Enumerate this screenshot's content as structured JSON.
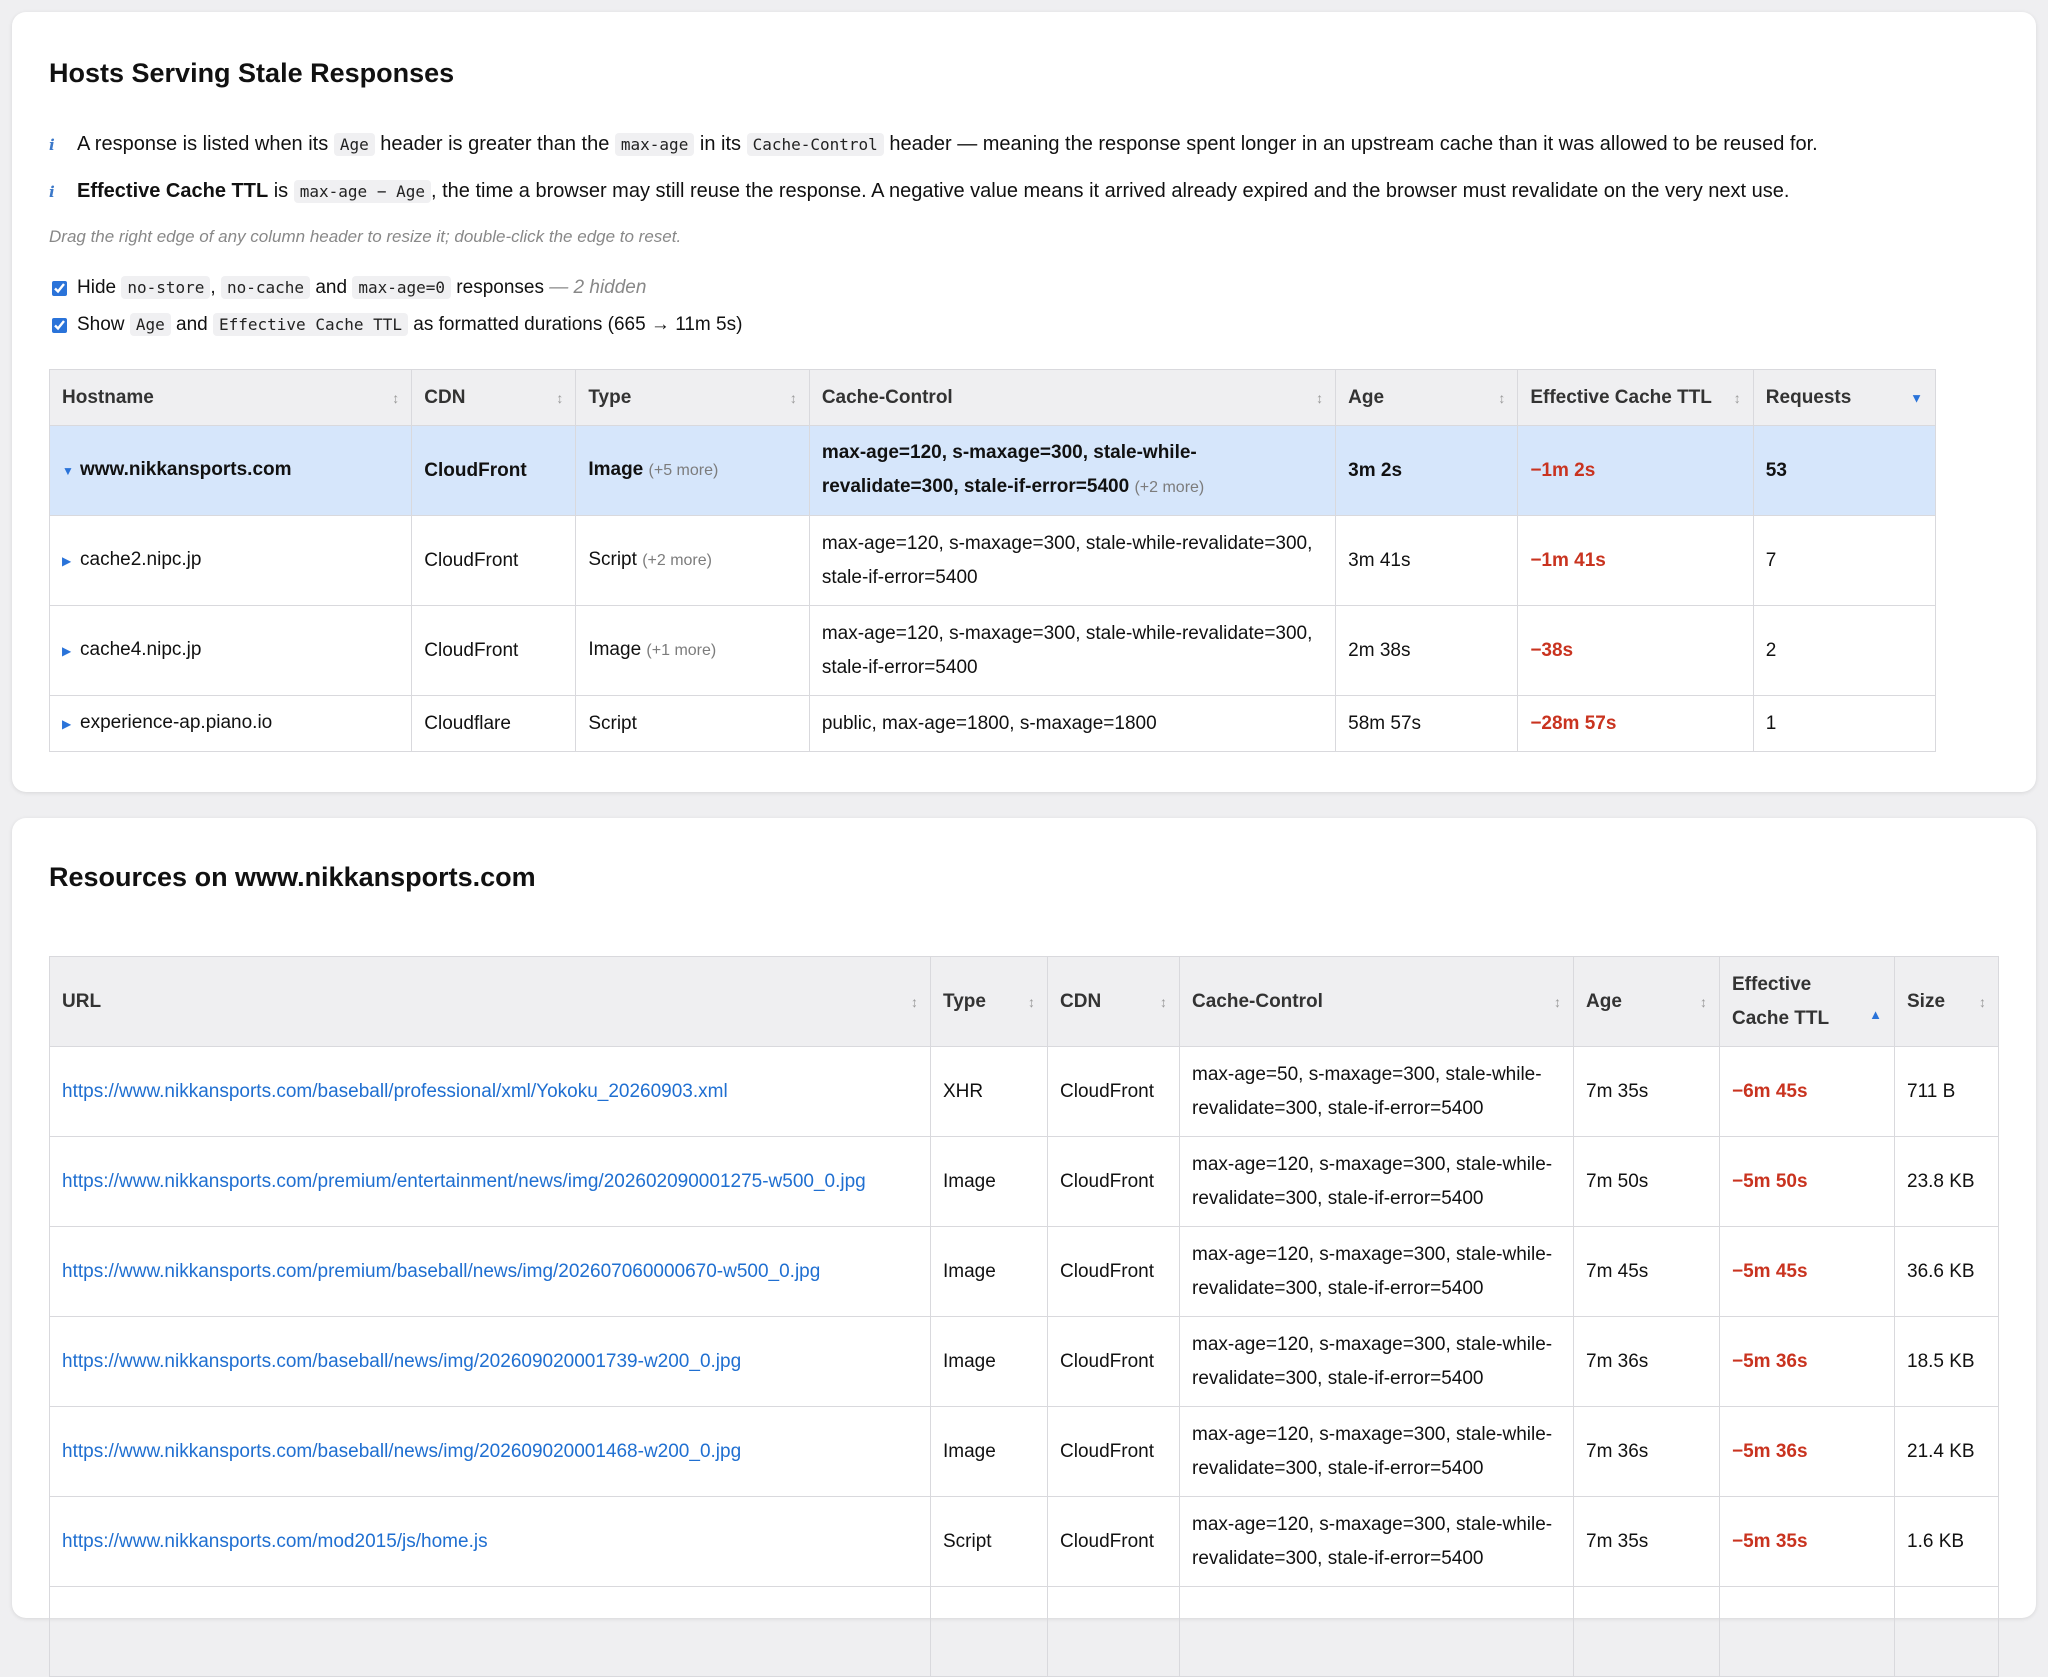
{
  "hosts_panel": {
    "title": "Hosts Serving Stale Responses",
    "info1": {
      "t1": "A response is listed when its",
      "c1": "Age",
      "t2": "header is greater than the",
      "c2": "max-age",
      "t3": "in its",
      "c3": "Cache-Control",
      "t4": "header — meaning the response spent longer in an upstream cache than it was allowed to be reused for."
    },
    "info2": {
      "bold": "Effective Cache TTL",
      "t1": "is",
      "c1": "max-age − Age",
      "t2": ", the time a browser may still reuse the response. A negative value means it arrived already expired and the browser must revalidate on the very next use."
    },
    "hint": "Drag the right edge of any column header to resize it; double-click the edge to reset.",
    "check_hide": {
      "t1": "Hide",
      "c1": "no-store",
      "sep": ",",
      "c2": "no-cache",
      "t2": "and",
      "c3": "max-age=0",
      "t3": "responses",
      "note": "— 2 hidden"
    },
    "check_show": {
      "t1": "Show",
      "c1": "Age",
      "t2": "and",
      "c2": "Effective Cache TTL",
      "t3": "as formatted durations (665 → 11m 5s)"
    },
    "columns": [
      "Hostname",
      "CDN",
      "Type",
      "Cache-Control",
      "Age",
      "Effective Cache TTL",
      "Requests"
    ],
    "rows": [
      {
        "host": "www.nikkansports.com",
        "cdn": "CloudFront",
        "type": "Image",
        "type_more": "(+5 more)",
        "cc": "max-age=120, s-maxage=300, stale-while-revalidate=300, stale-if-error=5400",
        "cc_more": "(+2 more)",
        "age": "3m 2s",
        "ttl": "−1m 2s",
        "req": "53"
      },
      {
        "host": "cache2.nipc.jp",
        "cdn": "CloudFront",
        "type": "Script",
        "type_more": "(+2 more)",
        "cc": "max-age=120, s-maxage=300, stale-while-revalidate=300, stale-if-error=5400",
        "cc_more": "",
        "age": "3m 41s",
        "ttl": "−1m 41s",
        "req": "7"
      },
      {
        "host": "cache4.nipc.jp",
        "cdn": "CloudFront",
        "type": "Image",
        "type_more": "(+1 more)",
        "cc": "max-age=120, s-maxage=300, stale-while-revalidate=300, stale-if-error=5400",
        "cc_more": "",
        "age": "2m 38s",
        "ttl": "−38s",
        "req": "2"
      },
      {
        "host": "experience-ap.piano.io",
        "cdn": "Cloudflare",
        "type": "Script",
        "type_more": "",
        "cc": "public, max-age=1800, s-maxage=1800",
        "cc_more": "",
        "age": "58m 57s",
        "ttl": "−28m 57s",
        "req": "1"
      }
    ]
  },
  "resources_panel": {
    "title": "Resources on www.nikkansports.com",
    "columns": [
      "URL",
      "Type",
      "CDN",
      "Cache-Control",
      "Age",
      "Effective Cache TTL",
      "Size"
    ],
    "rows": [
      {
        "url": "https://www.nikkansports.com/baseball/professional/xml/Yokoku_20260903.xml",
        "type": "XHR",
        "cdn": "CloudFront",
        "cc": "max-age=50, s-maxage=300, stale-while-revalidate=300, stale-if-error=5400",
        "age": "7m 35s",
        "ttl": "−6m 45s",
        "size": "711 B"
      },
      {
        "url": "https://www.nikkansports.com/premium/entertainment/news/img/202602090001275-w500_0.jpg",
        "type": "Image",
        "cdn": "CloudFront",
        "cc": "max-age=120, s-maxage=300, stale-while-revalidate=300, stale-if-error=5400",
        "age": "7m 50s",
        "ttl": "−5m 50s",
        "size": "23.8 KB"
      },
      {
        "url": "https://www.nikkansports.com/premium/baseball/news/img/202607060000670-w500_0.jpg",
        "type": "Image",
        "cdn": "CloudFront",
        "cc": "max-age=120, s-maxage=300, stale-while-revalidate=300, stale-if-error=5400",
        "age": "7m 45s",
        "ttl": "−5m 45s",
        "size": "36.6 KB"
      },
      {
        "url": "https://www.nikkansports.com/baseball/news/img/202609020001739-w200_0.jpg",
        "type": "Image",
        "cdn": "CloudFront",
        "cc": "max-age=120, s-maxage=300, stale-while-revalidate=300, stale-if-error=5400",
        "age": "7m 36s",
        "ttl": "−5m 36s",
        "size": "18.5 KB"
      },
      {
        "url": "https://www.nikkansports.com/baseball/news/img/202609020001468-w200_0.jpg",
        "type": "Image",
        "cdn": "CloudFront",
        "cc": "max-age=120, s-maxage=300, stale-while-revalidate=300, stale-if-error=5400",
        "age": "7m 36s",
        "ttl": "−5m 36s",
        "size": "21.4 KB"
      },
      {
        "url": "https://www.nikkansports.com/mod2015/js/home.js",
        "type": "Script",
        "cdn": "CloudFront",
        "cc": "max-age=120, s-maxage=300, stale-while-revalidate=300, stale-if-error=5400",
        "age": "7m 35s",
        "ttl": "−5m 35s",
        "size": "1.6 KB"
      }
    ]
  },
  "icons": {
    "info": "info-icon",
    "sort": "sort-arrows-icon",
    "sort_desc": "sort-desc-icon",
    "sort_asc": "sort-asc-icon",
    "expand": "expand-triangle-icon",
    "collapse": "collapse-triangle-icon"
  },
  "colors": {
    "accent": "#2a73d9",
    "negative": "#c9331f",
    "selected_row": "#d6e6fb",
    "link": "#1f6fd1"
  }
}
